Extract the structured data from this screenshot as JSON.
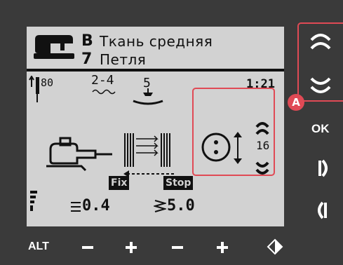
{
  "header": {
    "fabric_code": "B",
    "fabric_label": "Ткань средняя",
    "stitch_code": "7",
    "stitch_label": "Петля"
  },
  "status": {
    "needle_size": "80",
    "thread_tension": "2-4",
    "presser_foot": "5",
    "time": "1:21"
  },
  "buttonhole": {
    "button_size": "16"
  },
  "badges": {
    "fix": "Fix",
    "stop": "Stop"
  },
  "values": {
    "stitch_width": "0.4",
    "stitch_length": "5.0"
  },
  "side_buttons": {
    "ok_label": "OK"
  },
  "bottom_buttons": {
    "alt_label": "ALT"
  },
  "callout": {
    "label": "A"
  },
  "colors": {
    "screen_bg": "#d2d2d2",
    "bezel": "#3a3a3a",
    "highlight": "#e04a55",
    "ink": "#111111"
  }
}
